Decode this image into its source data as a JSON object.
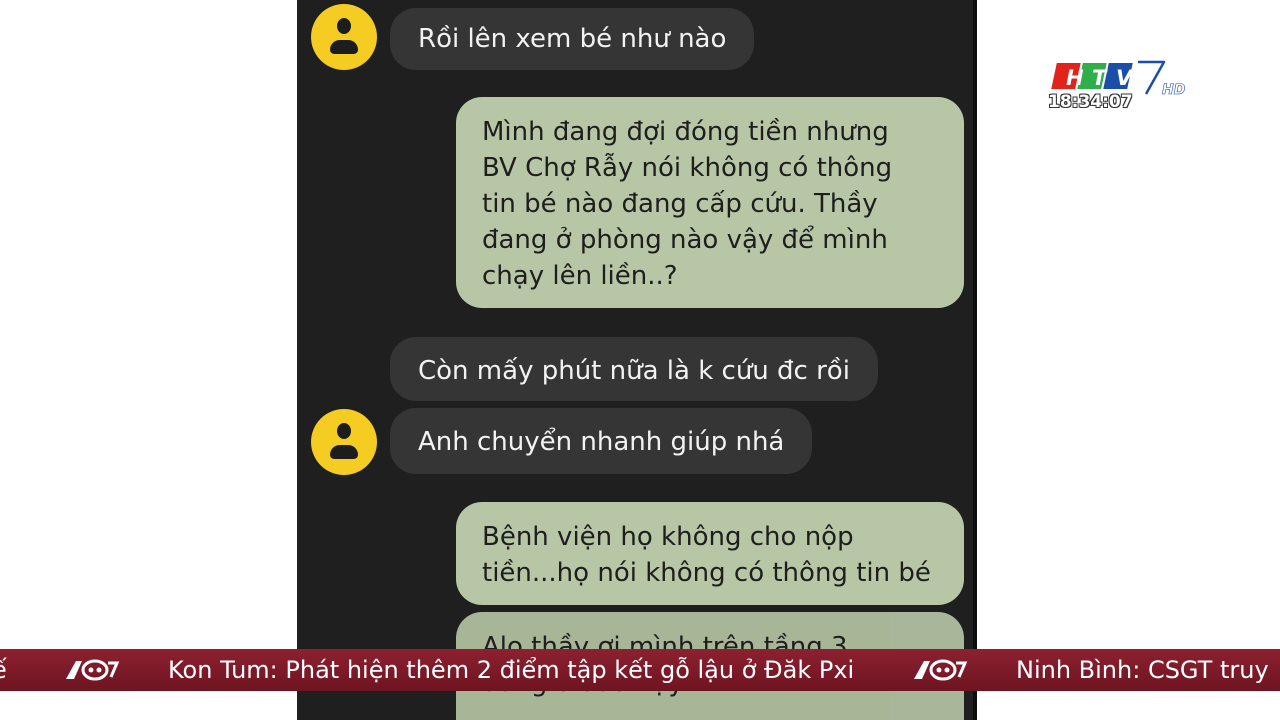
{
  "channel": {
    "clock": "18:34:07",
    "brand_colors": {
      "red": "#e2231a",
      "green": "#2fae4a",
      "blue": "#1a4ea8",
      "white": "#ffffff"
    }
  },
  "chat": {
    "messages": [
      {
        "side": "incoming",
        "text": "Rồi lên xem bé như nào"
      },
      {
        "side": "outgoing",
        "text": "Mình đang đợi đóng tiền nhưng\nBV Chợ Rẫy nói không có thông\ntin bé nào đang cấp cứu. Thầy\nđang ở phòng nào vậy để mình\nchạy lên liền..?"
      },
      {
        "side": "incoming",
        "text": "Còn mấy phút nữa là k cứu đc rồi"
      },
      {
        "side": "incoming",
        "text": "Anh chuyển nhanh giúp nhá"
      },
      {
        "side": "outgoing",
        "text": "Bệnh viện họ không cho nộp\ntiền...họ nói không có thông tin bé"
      },
      {
        "side": "outgoing",
        "text": "Alo thầy ơi mình trên tầng 3\nđang ở đâu vậy????"
      }
    ],
    "colors": {
      "background": "#1f1f1f",
      "incoming_bubble": "#353535",
      "outgoing_bubble": "#b7c7a6",
      "avatar": "#f5cc22"
    }
  },
  "ticker": {
    "prev_tail": "ế",
    "headline": "Kon Tum: Phát hiện thêm 2 điểm tập kết gỗ lậu ở Đăk Pxi",
    "next_headline": "Ninh Bình: CSGT truy",
    "color": "#7a1826"
  }
}
